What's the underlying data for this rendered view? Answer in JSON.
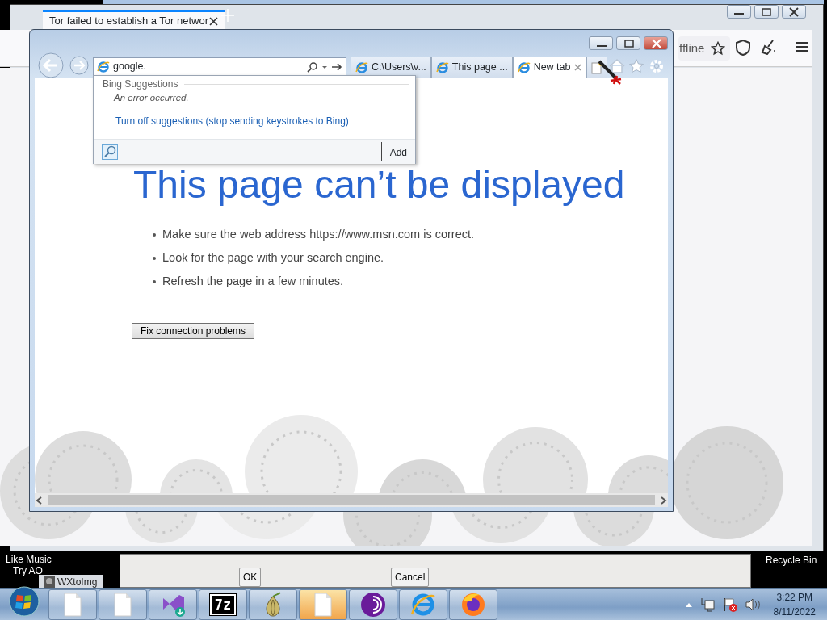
{
  "desktop_labels": [
    {
      "text": "Like Music"
    },
    {
      "text": "Try AO"
    },
    {
      "text": "Recycle Bin"
    }
  ],
  "tor_window": {
    "tab_title": "Tor failed to establish a Tor networ",
    "address_text": "ffline"
  },
  "dialog": {
    "buttons": [
      "OK",
      "Cancel"
    ]
  },
  "background_window": {
    "title": "WXtoImg"
  },
  "ie_window": {
    "address": "google.",
    "tabs": [
      {
        "title": "C:\\Users\\v...",
        "selected": false
      },
      {
        "title": "This page ...",
        "selected": false
      },
      {
        "title": "New tab",
        "selected": true
      }
    ],
    "suggestions": {
      "header": "Bing Suggestions",
      "message": "An error occurred.",
      "link": "Turn off suggestions (stop sending keystrokes to Bing)",
      "add_label": "Add"
    },
    "page": {
      "heading": "This page can’t be displayed",
      "bullets": [
        "Make sure the web address https://www.msn.com is correct.",
        "Look for the page with your search engine.",
        "Refresh the page in a few minutes."
      ],
      "button": "Fix connection problems"
    }
  },
  "taskbar": {
    "apps": [
      {
        "kind": "file",
        "selected": false
      },
      {
        "kind": "file",
        "selected": false
      },
      {
        "kind": "studio",
        "selected": false
      },
      {
        "kind": "archive",
        "label": "7z",
        "selected": false
      },
      {
        "kind": "onion",
        "selected": false
      },
      {
        "kind": "file",
        "selected": true
      },
      {
        "kind": "tor",
        "selected": false
      },
      {
        "kind": "ie",
        "selected": false
      },
      {
        "kind": "firefox",
        "selected": false
      }
    ],
    "time": "3:22 PM",
    "date": "8/11/2022"
  }
}
